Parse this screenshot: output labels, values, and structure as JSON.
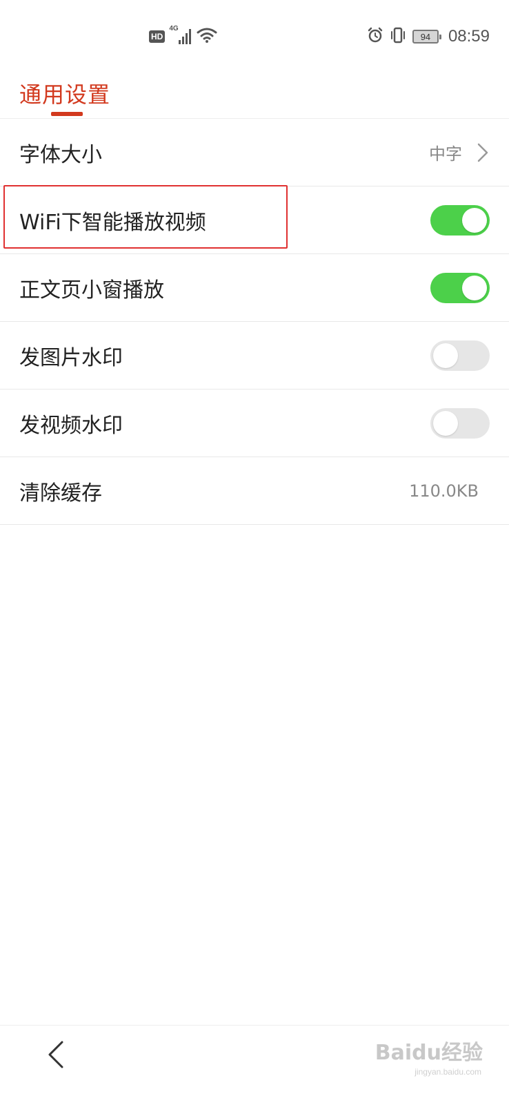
{
  "status_bar": {
    "hd_label": "HD",
    "network_label": "4G",
    "battery_level": "94",
    "time": "08:59",
    "icons": [
      "hd-icon",
      "signal-icon",
      "wifi-icon",
      "alarm-icon",
      "vibrate-icon",
      "battery-icon"
    ]
  },
  "header": {
    "title": "通用设置",
    "accent_color": "#d2391e"
  },
  "settings": {
    "font_size": {
      "label": "字体大小",
      "value": "中字"
    },
    "wifi_autoplay": {
      "label": "WiFi下智能播放视频",
      "enabled": true
    },
    "mini_window": {
      "label": "正文页小窗播放",
      "enabled": true
    },
    "image_watermark": {
      "label": "发图片水印",
      "enabled": false
    },
    "video_watermark": {
      "label": "发视频水印",
      "enabled": false
    },
    "clear_cache": {
      "label": "清除缓存",
      "value": "110.0KB"
    }
  },
  "toggle_colors": {
    "on": "#4cd04a",
    "off": "#e6e6e6"
  },
  "bottom_bar": {
    "back_icon": "chevron-left-icon",
    "watermark": "Baidu经验",
    "watermark_sub": "jingyan.baidu.com"
  }
}
